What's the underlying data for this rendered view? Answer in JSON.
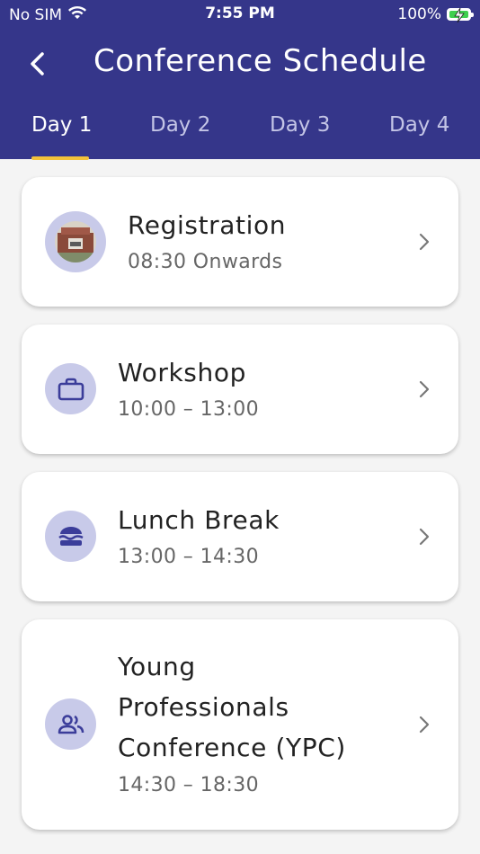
{
  "status_bar": {
    "carrier": "No SIM",
    "time": "7:55 PM",
    "battery": "100%"
  },
  "header": {
    "title": "Conference Schedule"
  },
  "tabs": [
    {
      "label": "Day 1",
      "active": true
    },
    {
      "label": "Day 2",
      "active": false
    },
    {
      "label": "Day 3",
      "active": false
    },
    {
      "label": "Day 4",
      "active": false
    }
  ],
  "schedule": [
    {
      "title": "Registration",
      "time": "08:30 Onwards",
      "icon": "building-photo-icon"
    },
    {
      "title": "Workshop",
      "time": "10:00 – 13:00",
      "icon": "briefcase-icon"
    },
    {
      "title": "Lunch Break",
      "time": "13:00 – 14:30",
      "icon": "burger-icon"
    },
    {
      "title_lines": [
        "Young",
        "Professionals",
        "Conference (YPC)"
      ],
      "time": "14:30 – 18:30",
      "icon": "people-icon"
    }
  ],
  "colors": {
    "primary": "#35368a",
    "accent": "#f3c23a",
    "avatar_bg": "#c8cae9",
    "icon": "#3b3d9a"
  }
}
